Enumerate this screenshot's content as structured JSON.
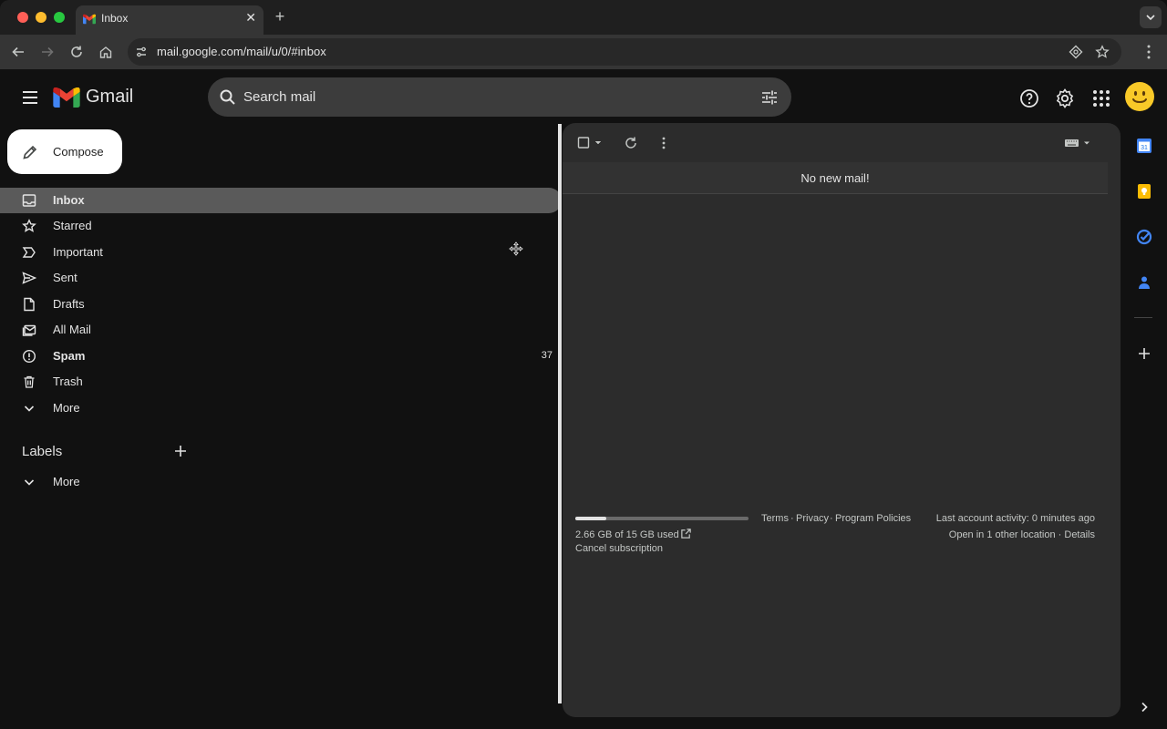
{
  "browser": {
    "tab_title": "Inbox",
    "tab_close": "✕",
    "new_tab": "+",
    "url": "mail.google.com/mail/u/0/#inbox"
  },
  "header": {
    "app_name": "Gmail",
    "search_placeholder": "Search mail"
  },
  "compose": {
    "label": "Compose"
  },
  "nav": {
    "items": [
      {
        "label": "Inbox",
        "icon": "inbox-icon",
        "active": true,
        "bold": true
      },
      {
        "label": "Starred",
        "icon": "star-icon"
      },
      {
        "label": "Important",
        "icon": "important-icon"
      },
      {
        "label": "Sent",
        "icon": "sent-icon"
      },
      {
        "label": "Drafts",
        "icon": "drafts-icon"
      },
      {
        "label": "All Mail",
        "icon": "all-mail-icon"
      },
      {
        "label": "Spam",
        "icon": "spam-icon",
        "bold": true,
        "count": "37"
      },
      {
        "label": "Trash",
        "icon": "trash-icon"
      },
      {
        "label": "More",
        "icon": "chevron-down-icon"
      }
    ],
    "labels_title": "Labels",
    "labels_more": "More"
  },
  "main": {
    "banner": "No new mail!",
    "storage_used_fraction": 0.18,
    "storage_text": "2.66 GB of 15 GB used",
    "cancel_subscription": "Cancel subscription",
    "terms": "Terms",
    "privacy": "Privacy",
    "program_policies": "Program Policies",
    "sep": "·",
    "last_activity": "Last account activity: 0 minutes ago",
    "open_locations": "Open in 1 other location",
    "details": "Details"
  },
  "colors": {
    "background": "#111111",
    "panel": "#2c2c2c",
    "active_nav": "#5a5a5a",
    "compose_bg": "#ffffff",
    "avatar": "#f9c928"
  }
}
